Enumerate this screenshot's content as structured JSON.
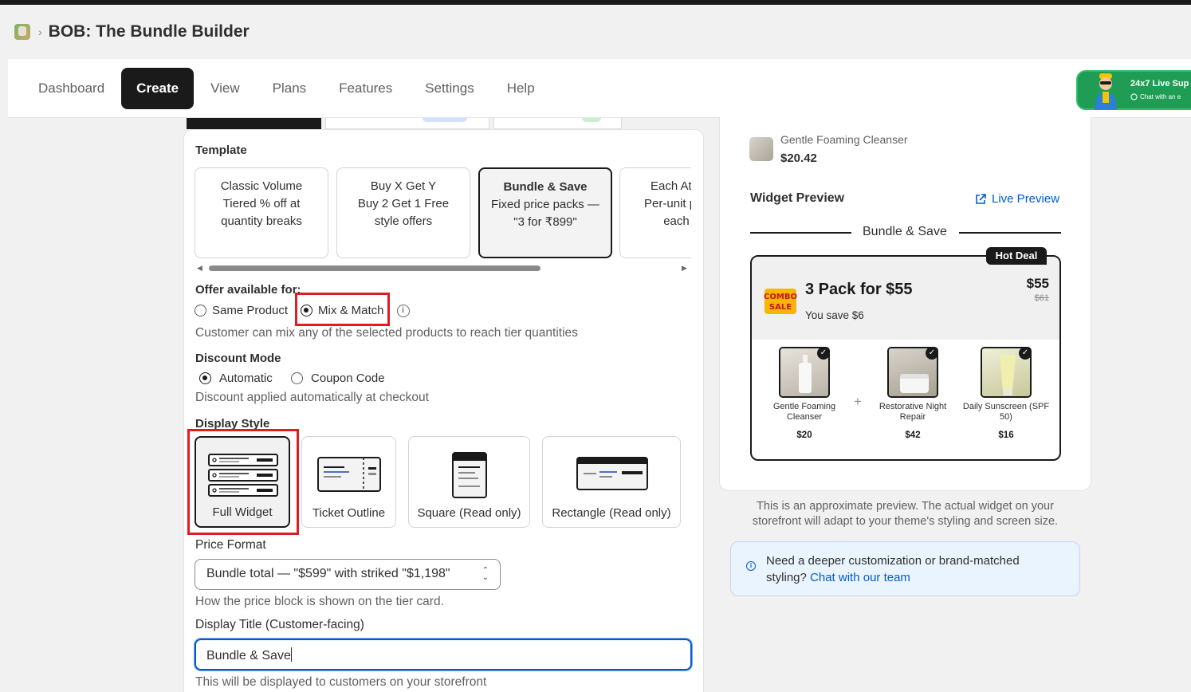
{
  "app": {
    "title": "BOB: The Bundle Builder",
    "breadcrumb_sep": "›"
  },
  "nav": {
    "items": [
      "Dashboard",
      "Create",
      "View",
      "Plans",
      "Features",
      "Settings",
      "Help"
    ],
    "active": "Create"
  },
  "support": {
    "title": "24x7 Live Sup",
    "subtitle": "Chat with an e"
  },
  "template": {
    "label": "Template",
    "options": [
      {
        "name": "Classic Volume",
        "desc": "Tiered % off at quantity breaks"
      },
      {
        "name": "Buy X Get Y",
        "desc": "Buy 2 Get 1 Free style offers"
      },
      {
        "name": "Bundle & Save",
        "desc": "Fixed price packs — \"3 for ₹899\""
      },
      {
        "name": "Each At Price",
        "desc": "Per-unit price at each tier"
      }
    ],
    "selected": "Bundle & Save",
    "scroll_left": "◀",
    "scroll_right": "▶"
  },
  "offer": {
    "label": "Offer available for:",
    "options": [
      "Same Product",
      "Mix & Match"
    ],
    "selected": "Mix & Match",
    "info_icon": "i",
    "helper": "Customer can mix any of the selected products to reach tier quantities"
  },
  "discount": {
    "label": "Discount Mode",
    "options": [
      "Automatic",
      "Coupon Code"
    ],
    "selected": "Automatic",
    "helper": "Discount applied automatically at checkout"
  },
  "display_style": {
    "label": "Display Style",
    "options": [
      "Full Widget",
      "Ticket Outline",
      "Square (Read only)",
      "Rectangle (Read only)"
    ],
    "selected": "Full Widget"
  },
  "price_format": {
    "label": "Price Format",
    "value": "Bundle total — \"$599\" with striked \"$1,198\"",
    "helper": "How the price block is shown on the tier card."
  },
  "display_title": {
    "label": "Display Title (Customer-facing)",
    "value": "Bundle & Save",
    "helper": "This will be displayed to customers on your storefront"
  },
  "preview": {
    "product": {
      "name": "Gentle Foaming Cleanser",
      "price": "$20.42"
    },
    "title": "Widget Preview",
    "live_preview": "Live Preview",
    "heading": "Bundle & Save",
    "badge": "Hot Deal",
    "logo_text": [
      "COMBO",
      "SALE"
    ],
    "tier": {
      "title": "3 Pack for $55",
      "save": "You save $6",
      "price": "$55",
      "compare_at": "$61"
    },
    "items": [
      {
        "name": "Gentle Foaming Cleanser",
        "price": "$20"
      },
      {
        "name": "Restorative Night Repair",
        "price": "$42"
      },
      {
        "name": "Daily Sunscreen (SPF 50)",
        "price": "$16"
      }
    ],
    "plus": "+",
    "approx_note": "This is an approximate preview. The actual widget on your storefront will adapt to your theme's styling and screen size."
  },
  "help": {
    "text": "Need a deeper customization or brand-matched styling?",
    "link": "Chat with our team"
  },
  "colors": {
    "accent": "#005bd3",
    "highlight": "#e11b22",
    "primary": "#1a1a1a",
    "support": "#1f9d55"
  }
}
